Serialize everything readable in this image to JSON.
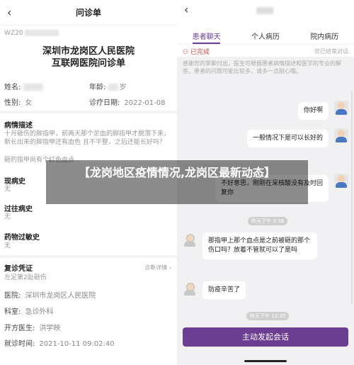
{
  "left": {
    "nav_title": "问诊单",
    "doc_no": "WZ20",
    "hospital_line1": "深圳市龙岗区人民医院",
    "hospital_line2": "互联网医院问诊单",
    "name_label": "姓名:",
    "age_label": "年龄:",
    "age_value": "岁",
    "gender_label": "性别:",
    "gender_value": "女",
    "date_label": "诊疗日期:",
    "date_value": "2022-01-08",
    "desc_title": "病情描述",
    "desc_text": "十月砸伤的脚指甲，前两天那个淤血的脚指甲才脱落下来，新长出来的脚指甲还有血色 且不平整，之后还能长好吗？",
    "desc_more": "砸的指甲尚有个红色血点",
    "current_title": "现病史",
    "current_value": "无",
    "past_title": "过往病史",
    "past_value": "无",
    "allergy_title": "药物过敏史",
    "allergy_value": "无",
    "review_title": "复诊凭证",
    "review_detail": "诊断详情",
    "review_value": "左足第2趾砸伤",
    "hospital_label": "医院:",
    "hospital_value": "深圳市龙岗区人民医院",
    "dept_label": "科室:",
    "dept_value": "急诊外科",
    "doctor_label": "开方医生:",
    "doctor_value": "洪学映",
    "visit_label": "就诊时间:",
    "visit_value": "2021-10-11 09:02:40"
  },
  "right": {
    "tabs": [
      "患者聊天",
      "个人病历",
      "院内病历"
    ],
    "status_done": "已完成",
    "status_read": "您已结束对话",
    "notice": "感谢您的掌聊付出，医生可根据患者病情描述和医学的专业的解答。患者的问题可能比较多，请多一点耐心哦。",
    "msg1": "你好啊",
    "msg2": "一般情况下是可以长好的",
    "msg3": "不好意思，刚刚在采核酸没有及时回复你",
    "ts1": "昨天下午 3:38",
    "msg4": "那指甲上那个血点是之前被砸的那个伤口吗？放着不管就可以了是吗",
    "msg5": "防疫辛苦了",
    "ts2": "昨天下午 12:35",
    "start_button": "主动发起会话"
  },
  "overlay_title": "【龙岗地区疫情情况,龙岗区最新动态】",
  "colors": {
    "accent": "#6b3e91",
    "done": "#c94b4b"
  }
}
